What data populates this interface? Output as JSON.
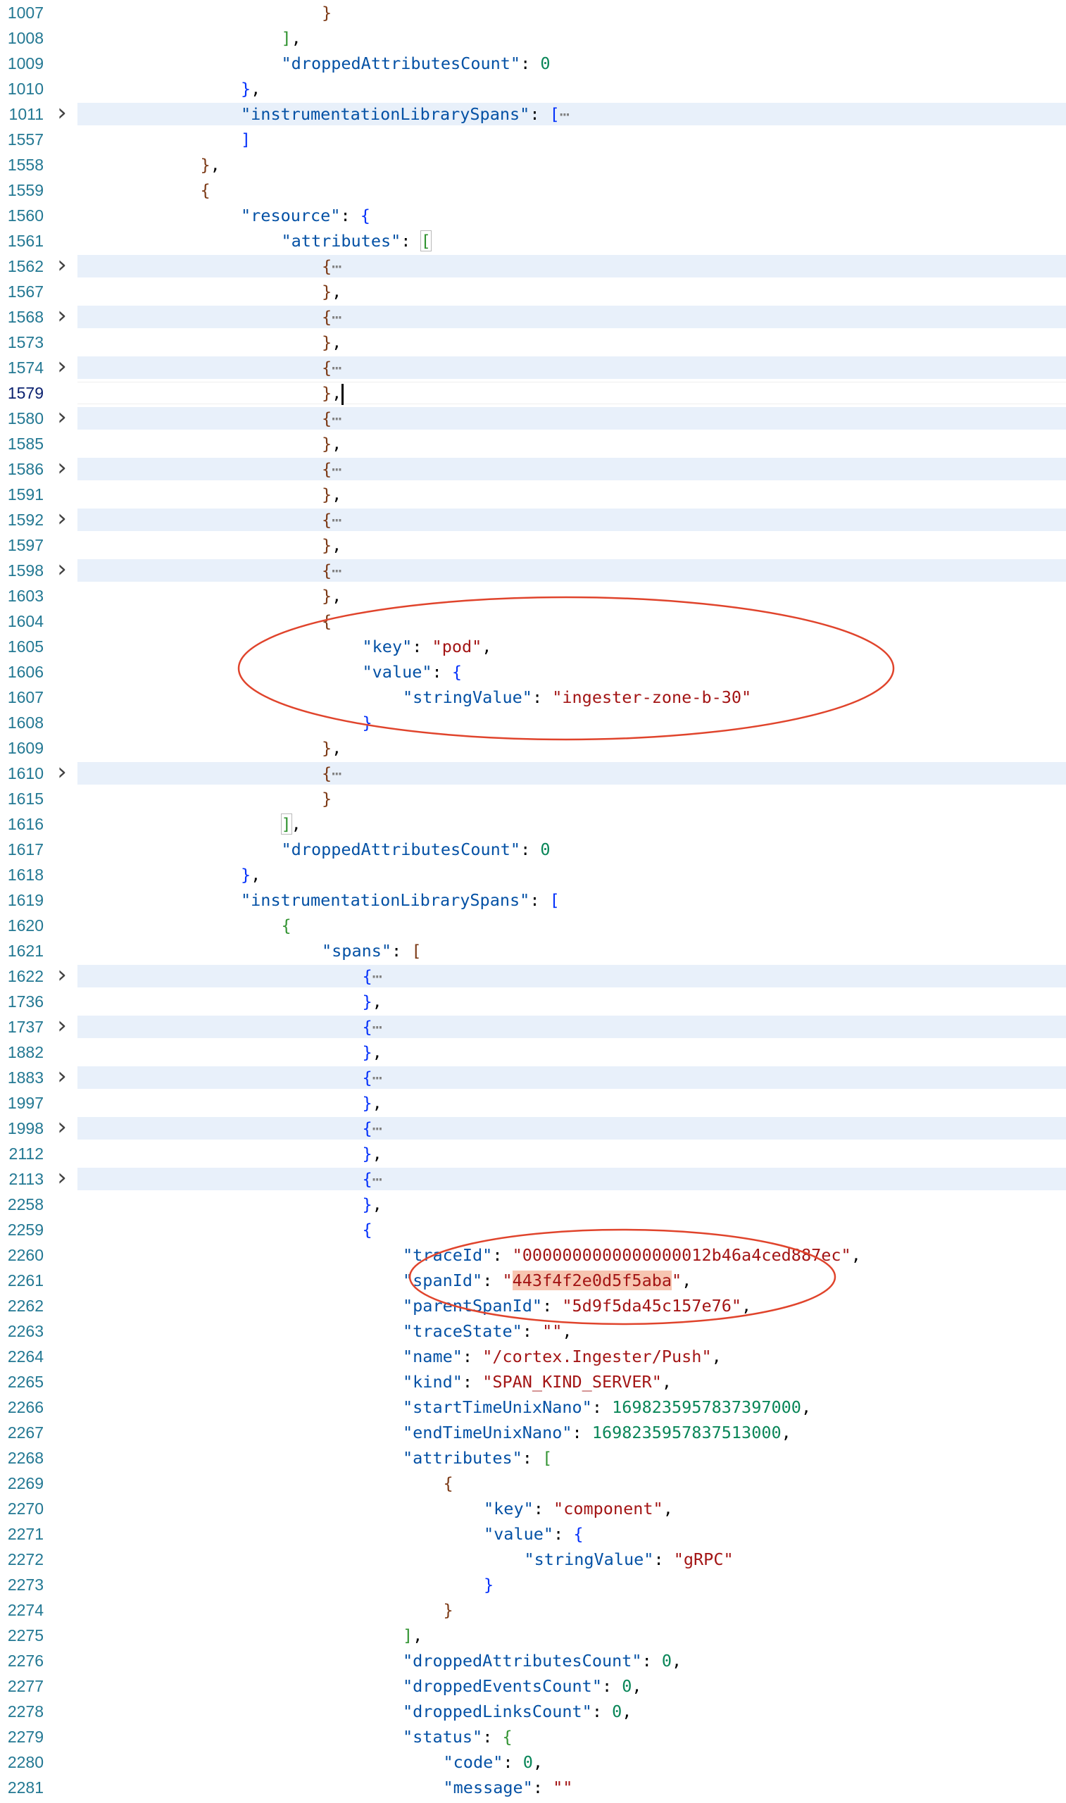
{
  "editor": {
    "theme": {
      "background": "#ffffff",
      "line_number": "#237893",
      "line_number_active": "#0b216f",
      "folded_band": "#e8f0fa",
      "key": "#0451a5",
      "string": "#a31515",
      "number": "#098658",
      "annotation": "#e0442c",
      "highlight": "#f7c5b1"
    },
    "fold_icon": "chevron-right-icon",
    "ellipsis": "⋯",
    "lines": [
      {
        "n": "1007",
        "indent": 6,
        "tokens": [
          [
            "}",
            "b2"
          ]
        ]
      },
      {
        "n": "1008",
        "indent": 5,
        "tokens": [
          [
            "]",
            "b1"
          ],
          [
            ",",
            "p"
          ]
        ]
      },
      {
        "n": "1009",
        "indent": 5,
        "tokens": [
          [
            "\"droppedAttributesCount\"",
            "key"
          ],
          [
            ": ",
            "p"
          ],
          [
            "0",
            "num"
          ]
        ]
      },
      {
        "n": "1010",
        "indent": 4,
        "tokens": [
          [
            "}",
            "b3"
          ],
          [
            ",",
            "p"
          ]
        ]
      },
      {
        "n": "1011",
        "indent": 4,
        "folded": true,
        "tokens": [
          [
            "\"instrumentationLibrarySpans\"",
            "key"
          ],
          [
            ": ",
            "p"
          ],
          [
            "[",
            "b3"
          ],
          [
            "⋯",
            "ell"
          ]
        ]
      },
      {
        "n": "1557",
        "indent": 4,
        "tokens": [
          [
            "]",
            "b3"
          ]
        ]
      },
      {
        "n": "1558",
        "indent": 3,
        "tokens": [
          [
            "}",
            "b2"
          ],
          [
            ",",
            "p"
          ]
        ]
      },
      {
        "n": "1559",
        "indent": 3,
        "tokens": [
          [
            "{",
            "b2"
          ]
        ]
      },
      {
        "n": "1560",
        "indent": 4,
        "tokens": [
          [
            "\"resource\"",
            "key"
          ],
          [
            ": ",
            "p"
          ],
          [
            "{",
            "b3"
          ]
        ]
      },
      {
        "n": "1561",
        "indent": 5,
        "tokens": [
          [
            "\"attributes\"",
            "key"
          ],
          [
            ": ",
            "p"
          ],
          [
            "[",
            "b1 match"
          ]
        ]
      },
      {
        "n": "1562",
        "indent": 6,
        "folded": true,
        "tokens": [
          [
            "{",
            "b2"
          ],
          [
            "⋯",
            "ell"
          ]
        ]
      },
      {
        "n": "1567",
        "indent": 6,
        "tokens": [
          [
            "}",
            "b2"
          ],
          [
            ",",
            "p"
          ]
        ]
      },
      {
        "n": "1568",
        "indent": 6,
        "folded": true,
        "tokens": [
          [
            "{",
            "b2"
          ],
          [
            "⋯",
            "ell"
          ]
        ]
      },
      {
        "n": "1573",
        "indent": 6,
        "tokens": [
          [
            "}",
            "b2"
          ],
          [
            ",",
            "p"
          ]
        ]
      },
      {
        "n": "1574",
        "indent": 6,
        "folded": true,
        "tokens": [
          [
            "{",
            "b2"
          ],
          [
            "⋯",
            "ell"
          ]
        ]
      },
      {
        "n": "1579",
        "indent": 6,
        "current": true,
        "caret": true,
        "tokens": [
          [
            "}",
            "b2"
          ],
          [
            ",",
            "p"
          ]
        ]
      },
      {
        "n": "1580",
        "indent": 6,
        "folded": true,
        "tokens": [
          [
            "{",
            "b2"
          ],
          [
            "⋯",
            "ell"
          ]
        ]
      },
      {
        "n": "1585",
        "indent": 6,
        "tokens": [
          [
            "}",
            "b2"
          ],
          [
            ",",
            "p"
          ]
        ]
      },
      {
        "n": "1586",
        "indent": 6,
        "folded": true,
        "tokens": [
          [
            "{",
            "b2"
          ],
          [
            "⋯",
            "ell"
          ]
        ]
      },
      {
        "n": "1591",
        "indent": 6,
        "tokens": [
          [
            "}",
            "b2"
          ],
          [
            ",",
            "p"
          ]
        ]
      },
      {
        "n": "1592",
        "indent": 6,
        "folded": true,
        "tokens": [
          [
            "{",
            "b2"
          ],
          [
            "⋯",
            "ell"
          ]
        ]
      },
      {
        "n": "1597",
        "indent": 6,
        "tokens": [
          [
            "}",
            "b2"
          ],
          [
            ",",
            "p"
          ]
        ]
      },
      {
        "n": "1598",
        "indent": 6,
        "folded": true,
        "tokens": [
          [
            "{",
            "b2"
          ],
          [
            "⋯",
            "ell"
          ]
        ]
      },
      {
        "n": "1603",
        "indent": 6,
        "tokens": [
          [
            "}",
            "b2"
          ],
          [
            ",",
            "p"
          ]
        ]
      },
      {
        "n": "1604",
        "indent": 6,
        "tokens": [
          [
            "{",
            "b2"
          ]
        ]
      },
      {
        "n": "1605",
        "indent": 7,
        "tokens": [
          [
            "\"key\"",
            "key"
          ],
          [
            ": ",
            "p"
          ],
          [
            "\"pod\"",
            "str"
          ],
          [
            ",",
            "p"
          ]
        ]
      },
      {
        "n": "1606",
        "indent": 7,
        "tokens": [
          [
            "\"value\"",
            "key"
          ],
          [
            ": ",
            "p"
          ],
          [
            "{",
            "b3"
          ]
        ]
      },
      {
        "n": "1607",
        "indent": 8,
        "tokens": [
          [
            "\"stringValue\"",
            "key"
          ],
          [
            ": ",
            "p"
          ],
          [
            "\"ingester-zone-b-30\"",
            "str"
          ]
        ]
      },
      {
        "n": "1608",
        "indent": 7,
        "tokens": [
          [
            "}",
            "b3"
          ]
        ]
      },
      {
        "n": "1609",
        "indent": 6,
        "tokens": [
          [
            "}",
            "b2"
          ],
          [
            ",",
            "p"
          ]
        ]
      },
      {
        "n": "1610",
        "indent": 6,
        "folded": true,
        "tokens": [
          [
            "{",
            "b2"
          ],
          [
            "⋯",
            "ell"
          ]
        ]
      },
      {
        "n": "1615",
        "indent": 6,
        "tokens": [
          [
            "}",
            "b2"
          ]
        ]
      },
      {
        "n": "1616",
        "indent": 5,
        "tokens": [
          [
            "]",
            "b1 match"
          ],
          [
            ",",
            "p"
          ]
        ]
      },
      {
        "n": "1617",
        "indent": 5,
        "tokens": [
          [
            "\"droppedAttributesCount\"",
            "key"
          ],
          [
            ": ",
            "p"
          ],
          [
            "0",
            "num"
          ]
        ]
      },
      {
        "n": "1618",
        "indent": 4,
        "tokens": [
          [
            "}",
            "b3"
          ],
          [
            ",",
            "p"
          ]
        ]
      },
      {
        "n": "1619",
        "indent": 4,
        "tokens": [
          [
            "\"instrumentationLibrarySpans\"",
            "key"
          ],
          [
            ": ",
            "p"
          ],
          [
            "[",
            "b3"
          ]
        ]
      },
      {
        "n": "1620",
        "indent": 5,
        "tokens": [
          [
            "{",
            "b1"
          ]
        ]
      },
      {
        "n": "1621",
        "indent": 6,
        "tokens": [
          [
            "\"spans\"",
            "key"
          ],
          [
            ": ",
            "p"
          ],
          [
            "[",
            "b2"
          ]
        ]
      },
      {
        "n": "1622",
        "indent": 7,
        "folded": true,
        "tokens": [
          [
            "{",
            "b3"
          ],
          [
            "⋯",
            "ell"
          ]
        ]
      },
      {
        "n": "1736",
        "indent": 7,
        "tokens": [
          [
            "}",
            "b3"
          ],
          [
            ",",
            "p"
          ]
        ]
      },
      {
        "n": "1737",
        "indent": 7,
        "folded": true,
        "tokens": [
          [
            "{",
            "b3"
          ],
          [
            "⋯",
            "ell"
          ]
        ]
      },
      {
        "n": "1882",
        "indent": 7,
        "tokens": [
          [
            "}",
            "b3"
          ],
          [
            ",",
            "p"
          ]
        ]
      },
      {
        "n": "1883",
        "indent": 7,
        "folded": true,
        "tokens": [
          [
            "{",
            "b3"
          ],
          [
            "⋯",
            "ell"
          ]
        ]
      },
      {
        "n": "1997",
        "indent": 7,
        "tokens": [
          [
            "}",
            "b3"
          ],
          [
            ",",
            "p"
          ]
        ]
      },
      {
        "n": "1998",
        "indent": 7,
        "folded": true,
        "tokens": [
          [
            "{",
            "b3"
          ],
          [
            "⋯",
            "ell"
          ]
        ]
      },
      {
        "n": "2112",
        "indent": 7,
        "tokens": [
          [
            "}",
            "b3"
          ],
          [
            ",",
            "p"
          ]
        ]
      },
      {
        "n": "2113",
        "indent": 7,
        "folded": true,
        "tokens": [
          [
            "{",
            "b3"
          ],
          [
            "⋯",
            "ell"
          ]
        ]
      },
      {
        "n": "2258",
        "indent": 7,
        "tokens": [
          [
            "}",
            "b3"
          ],
          [
            ",",
            "p"
          ]
        ]
      },
      {
        "n": "2259",
        "indent": 7,
        "tokens": [
          [
            "{",
            "b3"
          ]
        ]
      },
      {
        "n": "2260",
        "indent": 8,
        "tokens": [
          [
            "\"traceId\"",
            "key"
          ],
          [
            ": ",
            "p"
          ],
          [
            "\"0000000000000000012b46a4ced887ec\"",
            "str"
          ],
          [
            ",",
            "p"
          ]
        ]
      },
      {
        "n": "2261",
        "indent": 8,
        "tokens": [
          [
            "\"spanId\"",
            "key"
          ],
          [
            ": ",
            "p"
          ],
          [
            "\"",
            "str"
          ],
          [
            "443f4f2e0d5f5aba",
            "str hl"
          ],
          [
            "\"",
            "str"
          ],
          [
            ",",
            "p"
          ]
        ]
      },
      {
        "n": "2262",
        "indent": 8,
        "tokens": [
          [
            "\"parentSpanId\"",
            "key"
          ],
          [
            ": ",
            "p"
          ],
          [
            "\"5d9f5da45c157e76\"",
            "str"
          ],
          [
            ",",
            "p"
          ]
        ]
      },
      {
        "n": "2263",
        "indent": 8,
        "tokens": [
          [
            "\"traceState\"",
            "key"
          ],
          [
            ": ",
            "p"
          ],
          [
            "\"\"",
            "str"
          ],
          [
            ",",
            "p"
          ]
        ]
      },
      {
        "n": "2264",
        "indent": 8,
        "tokens": [
          [
            "\"name\"",
            "key"
          ],
          [
            ": ",
            "p"
          ],
          [
            "\"/cortex.Ingester/Push\"",
            "str"
          ],
          [
            ",",
            "p"
          ]
        ]
      },
      {
        "n": "2265",
        "indent": 8,
        "tokens": [
          [
            "\"kind\"",
            "key"
          ],
          [
            ": ",
            "p"
          ],
          [
            "\"SPAN_KIND_SERVER\"",
            "str"
          ],
          [
            ",",
            "p"
          ]
        ]
      },
      {
        "n": "2266",
        "indent": 8,
        "tokens": [
          [
            "\"startTimeUnixNano\"",
            "key"
          ],
          [
            ": ",
            "p"
          ],
          [
            "1698235957837397000",
            "num"
          ],
          [
            ",",
            "p"
          ]
        ]
      },
      {
        "n": "2267",
        "indent": 8,
        "tokens": [
          [
            "\"endTimeUnixNano\"",
            "key"
          ],
          [
            ": ",
            "p"
          ],
          [
            "1698235957837513000",
            "num"
          ],
          [
            ",",
            "p"
          ]
        ]
      },
      {
        "n": "2268",
        "indent": 8,
        "tokens": [
          [
            "\"attributes\"",
            "key"
          ],
          [
            ": ",
            "p"
          ],
          [
            "[",
            "b1"
          ]
        ]
      },
      {
        "n": "2269",
        "indent": 9,
        "tokens": [
          [
            "{",
            "b2"
          ]
        ]
      },
      {
        "n": "2270",
        "indent": 10,
        "tokens": [
          [
            "\"key\"",
            "key"
          ],
          [
            ": ",
            "p"
          ],
          [
            "\"component\"",
            "str"
          ],
          [
            ",",
            "p"
          ]
        ]
      },
      {
        "n": "2271",
        "indent": 10,
        "tokens": [
          [
            "\"value\"",
            "key"
          ],
          [
            ": ",
            "p"
          ],
          [
            "{",
            "b3"
          ]
        ]
      },
      {
        "n": "2272",
        "indent": 11,
        "tokens": [
          [
            "\"stringValue\"",
            "key"
          ],
          [
            ": ",
            "p"
          ],
          [
            "\"gRPC\"",
            "str"
          ]
        ]
      },
      {
        "n": "2273",
        "indent": 10,
        "tokens": [
          [
            "}",
            "b3"
          ]
        ]
      },
      {
        "n": "2274",
        "indent": 9,
        "tokens": [
          [
            "}",
            "b2"
          ]
        ]
      },
      {
        "n": "2275",
        "indent": 8,
        "tokens": [
          [
            "]",
            "b1"
          ],
          [
            ",",
            "p"
          ]
        ]
      },
      {
        "n": "2276",
        "indent": 8,
        "tokens": [
          [
            "\"droppedAttributesCount\"",
            "key"
          ],
          [
            ": ",
            "p"
          ],
          [
            "0",
            "num"
          ],
          [
            ",",
            "p"
          ]
        ]
      },
      {
        "n": "2277",
        "indent": 8,
        "tokens": [
          [
            "\"droppedEventsCount\"",
            "key"
          ],
          [
            ": ",
            "p"
          ],
          [
            "0",
            "num"
          ],
          [
            ",",
            "p"
          ]
        ]
      },
      {
        "n": "2278",
        "indent": 8,
        "tokens": [
          [
            "\"droppedLinksCount\"",
            "key"
          ],
          [
            ": ",
            "p"
          ],
          [
            "0",
            "num"
          ],
          [
            ",",
            "p"
          ]
        ]
      },
      {
        "n": "2279",
        "indent": 8,
        "tokens": [
          [
            "\"status\"",
            "key"
          ],
          [
            ": ",
            "p"
          ],
          [
            "{",
            "b1"
          ]
        ]
      },
      {
        "n": "2280",
        "indent": 9,
        "tokens": [
          [
            "\"code\"",
            "key"
          ],
          [
            ": ",
            "p"
          ],
          [
            "0",
            "num"
          ],
          [
            ",",
            "p"
          ]
        ]
      },
      {
        "n": "2281",
        "indent": 9,
        "tokens": [
          [
            "\"message\"",
            "key"
          ],
          [
            ": ",
            "p"
          ],
          [
            "\"\"",
            "str"
          ]
        ]
      }
    ]
  }
}
